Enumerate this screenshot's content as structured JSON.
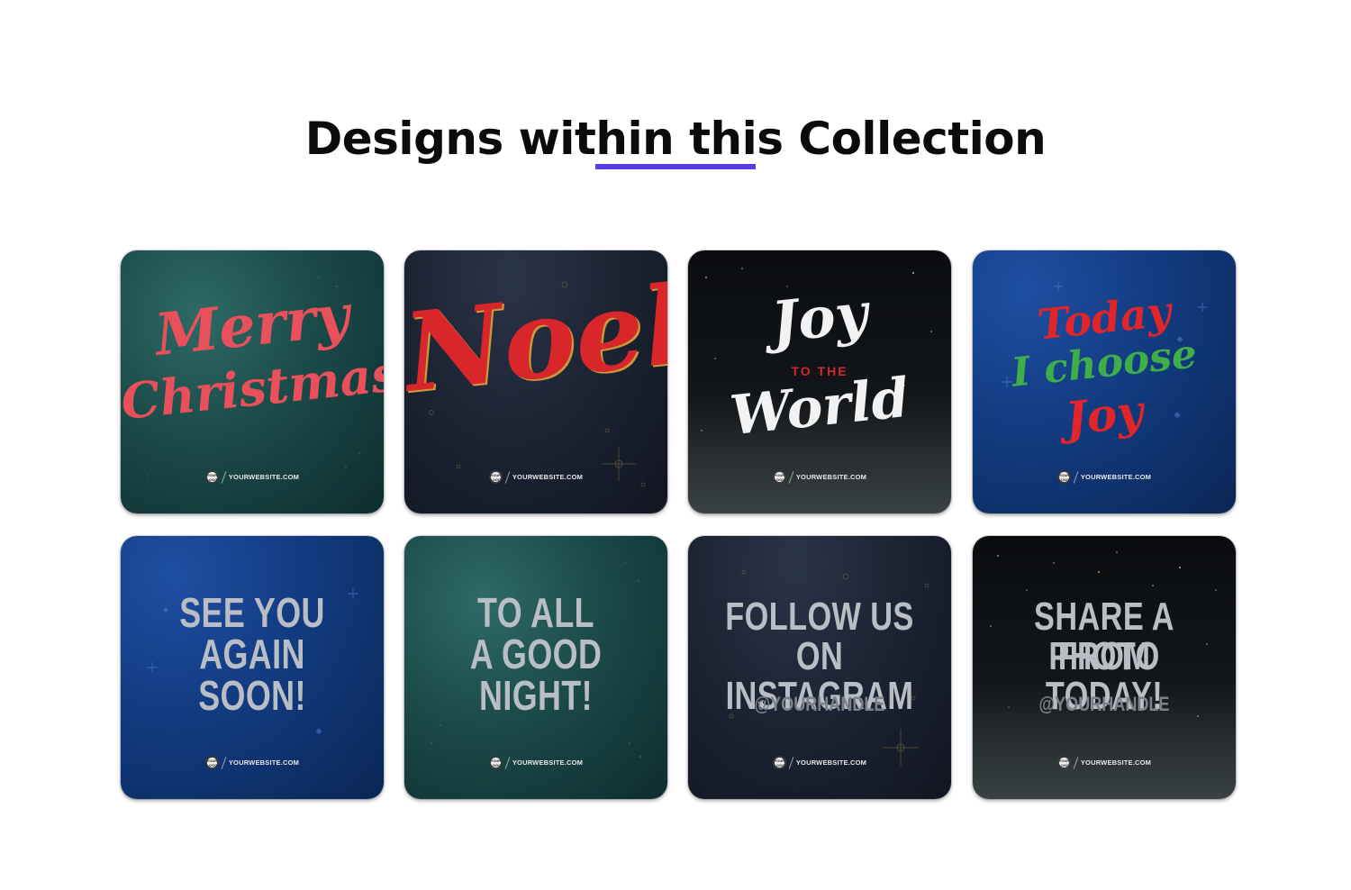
{
  "header": {
    "title": "Designs within this Collection",
    "accent_color": "#5b3be8"
  },
  "cards": [
    {
      "id": "merry-christmas",
      "lines": [
        "Merry",
        "Christmas"
      ],
      "style": "script",
      "color": "#e8505b",
      "website": "YOURWEBSITE.COM",
      "logo": "YOUR LOGO"
    },
    {
      "id": "noel",
      "lines": [
        "Noel"
      ],
      "style": "script",
      "color": "#d9262a",
      "website": "YOURWEBSITE.COM",
      "logo": "YOUR LOGO"
    },
    {
      "id": "joy-to-the-world",
      "lines": [
        "Joy",
        "TO THE",
        "World"
      ],
      "style": "script",
      "color": "#f2f2f2",
      "accent": "#d9262a",
      "website": "YOURWEBSITE.COM",
      "logo": "YOUR LOGO"
    },
    {
      "id": "today-i-choose-joy",
      "lines": [
        "Today",
        "I choose",
        "Joy"
      ],
      "style": "script",
      "colors": [
        "#e0262a",
        "#3fae4a",
        "#e0262a"
      ],
      "website": "YOURWEBSITE.COM",
      "logo": "YOUR LOGO"
    },
    {
      "id": "see-you-again-soon",
      "lines": [
        "SEE YOU",
        "AGAIN",
        "SOON!"
      ],
      "style": "block",
      "website": "YOURWEBSITE.COM",
      "logo": "YOUR LOGO"
    },
    {
      "id": "to-all-a-good-night",
      "lines": [
        "TO ALL",
        "A GOOD",
        "NIGHT!"
      ],
      "style": "block",
      "website": "YOURWEBSITE.COM",
      "logo": "YOUR LOGO"
    },
    {
      "id": "follow-us",
      "lines": [
        "FOLLOW US",
        "ON INSTAGRAM"
      ],
      "handle": "@YOURHANDLE",
      "style": "block",
      "website": "YOURWEBSITE.COM",
      "logo": "YOUR LOGO"
    },
    {
      "id": "share-a-photo",
      "lines": [
        "SHARE A PHOTO",
        "FROM TODAY!"
      ],
      "handle": "@YOURHANDLE",
      "style": "block",
      "website": "YOURWEBSITE.COM",
      "logo": "YOUR LOGO"
    }
  ]
}
